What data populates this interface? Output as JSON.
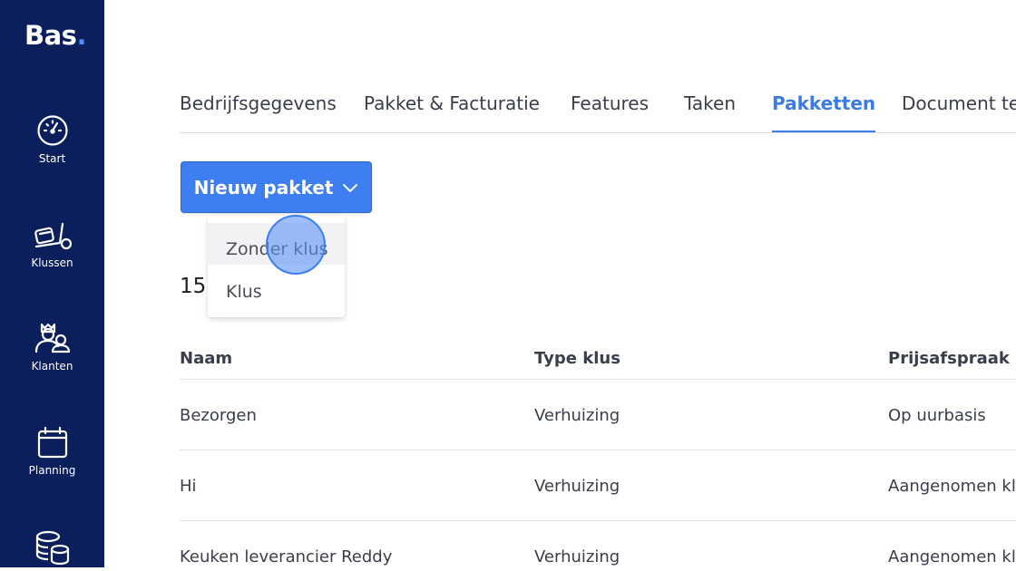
{
  "app": {
    "logo_text": "Bas",
    "logo_dot": "."
  },
  "sidebar": {
    "items": [
      {
        "label": "Start",
        "icon": "gauge-icon"
      },
      {
        "label": "Klussen",
        "icon": "dolly-icon"
      },
      {
        "label": "Klanten",
        "icon": "users-icon"
      },
      {
        "label": "Planning",
        "icon": "calendar-icon"
      },
      {
        "label": "",
        "icon": "coins-icon"
      }
    ]
  },
  "tabs": [
    {
      "label": "Bedrijfsgegevens"
    },
    {
      "label": "Pakket & Facturatie"
    },
    {
      "label": "Features"
    },
    {
      "label": "Taken"
    },
    {
      "label": "Pakketten",
      "active": true
    },
    {
      "label": "Document te"
    }
  ],
  "toolbar": {
    "new_package_label": "Nieuw pakket"
  },
  "dropdown": {
    "items": [
      {
        "label": "Zonder klus"
      },
      {
        "label": "Klus"
      }
    ]
  },
  "count": "15",
  "table": {
    "headers": [
      "Naam",
      "Type klus",
      "Prijsafspraak"
    ],
    "rows": [
      [
        "Bezorgen",
        "Verhuizing",
        "Op uurbasis"
      ],
      [
        "Hi",
        "Verhuizing",
        "Aangenomen klus"
      ],
      [
        "Keuken leverancier Reddy",
        "Verhuizing",
        "Aangenomen klus"
      ]
    ]
  },
  "colors": {
    "sidebar": "#0b1f5c",
    "accent": "#3d7ff0",
    "active_tab": "#3b7be3"
  }
}
